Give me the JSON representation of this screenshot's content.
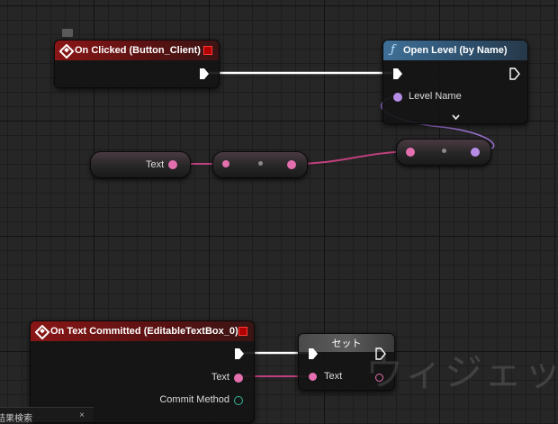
{
  "nodes": {
    "on_clicked": {
      "title": "On Clicked (Button_Client)"
    },
    "open_level": {
      "title": "Open Level (by Name)",
      "icon_glyph": "ƒ",
      "level_name_label": "Level Name",
      "expand_glyph": "⌄"
    },
    "text_node": {
      "label": "Text"
    },
    "on_text_committed": {
      "title": "On Text Committed (EditableTextBox_0)",
      "text_label": "Text",
      "commit_method_label": "Commit Method"
    },
    "set_node": {
      "title": "セット",
      "text_label": "Text"
    }
  },
  "watermark": "ウィジェッ",
  "bottom_tab": {
    "label": "結果検索",
    "close": "×"
  },
  "colors": {
    "event_red": "#8a1616",
    "function_blue": "#3f6f96",
    "text_pin": "#e46fae",
    "name_pin": "#b58de6",
    "exec": "#ffffff"
  }
}
